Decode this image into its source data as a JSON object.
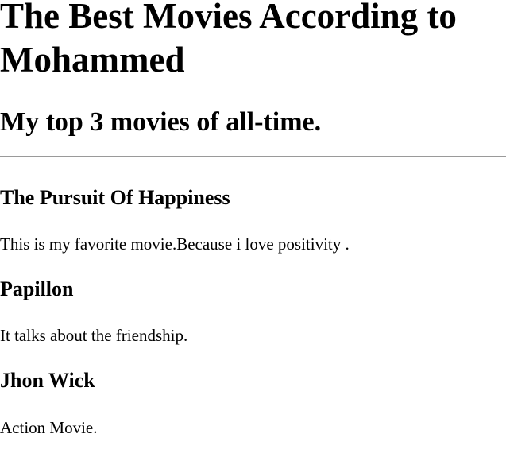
{
  "page": {
    "title": "The Best Movies According to Mohammed",
    "subtitle": "My top 3 movies of all-time."
  },
  "movies": [
    {
      "title": "The Pursuit Of Happiness",
      "description": "This is my favorite movie.Because i love positivity ."
    },
    {
      "title": "Papillon",
      "description": "It talks about the friendship."
    },
    {
      "title": "Jhon Wick",
      "description": "Action Movie."
    }
  ]
}
